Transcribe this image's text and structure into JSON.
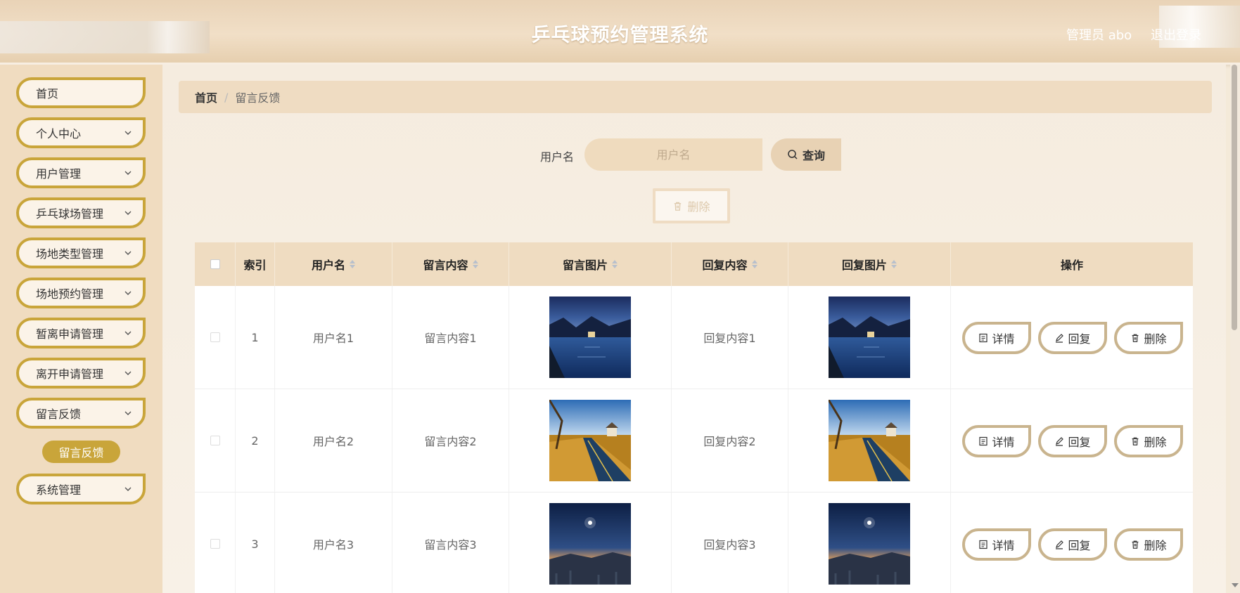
{
  "header": {
    "title": "乒乓球预约管理系统",
    "user": "管理员 abo",
    "logout": "退出登录"
  },
  "sidebar": {
    "items": [
      {
        "label": "首页",
        "has_children": false
      },
      {
        "label": "个人中心",
        "has_children": true
      },
      {
        "label": "用户管理",
        "has_children": true
      },
      {
        "label": "乒乓球场管理",
        "has_children": true
      },
      {
        "label": "场地类型管理",
        "has_children": true
      },
      {
        "label": "场地预约管理",
        "has_children": true
      },
      {
        "label": "暂离申请管理",
        "has_children": true
      },
      {
        "label": "离开申请管理",
        "has_children": true
      },
      {
        "label": "留言反馈",
        "has_children": true
      },
      {
        "label": "系统管理",
        "has_children": true
      }
    ],
    "active_sub_item": "留言反馈"
  },
  "breadcrumb": {
    "home": "首页",
    "separator": "/",
    "current": "留言反馈"
  },
  "search": {
    "label": "用户名",
    "placeholder": "用户名",
    "query_button": "查询"
  },
  "toolbar": {
    "delete_label": "删除"
  },
  "table": {
    "columns": {
      "index": "索引",
      "username": "用户名",
      "message_content": "留言内容",
      "message_image": "留言图片",
      "reply_content": "回复内容",
      "reply_image": "回复图片",
      "actions": "操作"
    },
    "rows": [
      {
        "index": "1",
        "username": "用户名1",
        "message_content": "留言内容1",
        "reply_content": "回复内容1",
        "image": "lake-night"
      },
      {
        "index": "2",
        "username": "用户名2",
        "message_content": "留言内容2",
        "reply_content": "回复内容2",
        "image": "autumn-road"
      },
      {
        "index": "3",
        "username": "用户名3",
        "message_content": "留言内容3",
        "reply_content": "回复内容3",
        "image": "starry-desert"
      }
    ],
    "actions": {
      "detail": "详情",
      "reply": "回复",
      "delete": "删除"
    }
  },
  "colors": {
    "accent_gold": "#c9a53a",
    "sidebar_bg": "#f0dcc0",
    "header_bg": "#eed9bc",
    "table_header_bg": "#efdcc1"
  }
}
